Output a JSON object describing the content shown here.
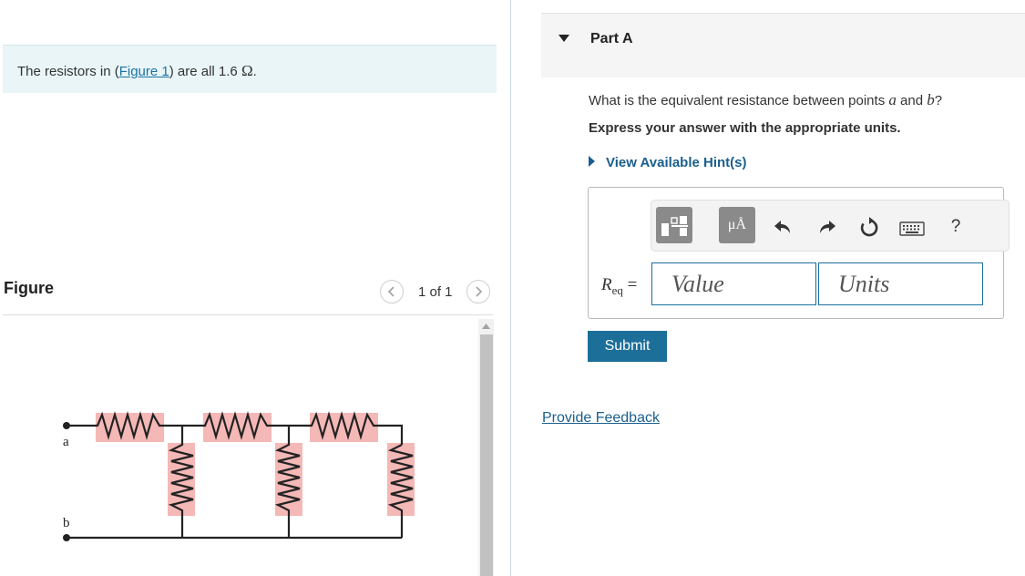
{
  "problem": {
    "text_before": "The resistors in (",
    "figure_link": "Figure 1",
    "text_after": ") are all 1.6 ",
    "unit": "Ω",
    "period": "."
  },
  "figure": {
    "heading": "Figure",
    "page_indicator": "1 of 1",
    "prev_icon": "chevron-left-icon",
    "next_icon": "chevron-right-icon",
    "node_a_label": "a",
    "node_b_label": "b",
    "resistor_highlight_color": "#f4b8b6"
  },
  "part": {
    "title": "Part A",
    "question_before": "What is the equivalent resistance between points ",
    "var_a": "a",
    "question_mid": " and ",
    "var_b": "b",
    "question_after": "?",
    "instruction": "Express your answer with the appropriate units.",
    "hint_link": "View Available Hint(s)"
  },
  "answer": {
    "label_var": "R",
    "label_sub": "eq",
    "label_eq": " =",
    "value_placeholder": "Value",
    "units_placeholder": "Units",
    "submit_label": "Submit",
    "units_glyph": "μÅ",
    "toolbar_icons": [
      "templates-icon",
      "units-icon",
      "undo-icon",
      "redo-icon",
      "reset-icon",
      "keyboard-icon",
      "help-icon"
    ],
    "help_label": "?"
  },
  "feedback_link": "Provide Feedback",
  "colors": {
    "link": "#1a5f8e",
    "submit_bg": "#1c6f99",
    "problem_bg": "#e9f5f6",
    "input_border": "#1a6f9e"
  }
}
